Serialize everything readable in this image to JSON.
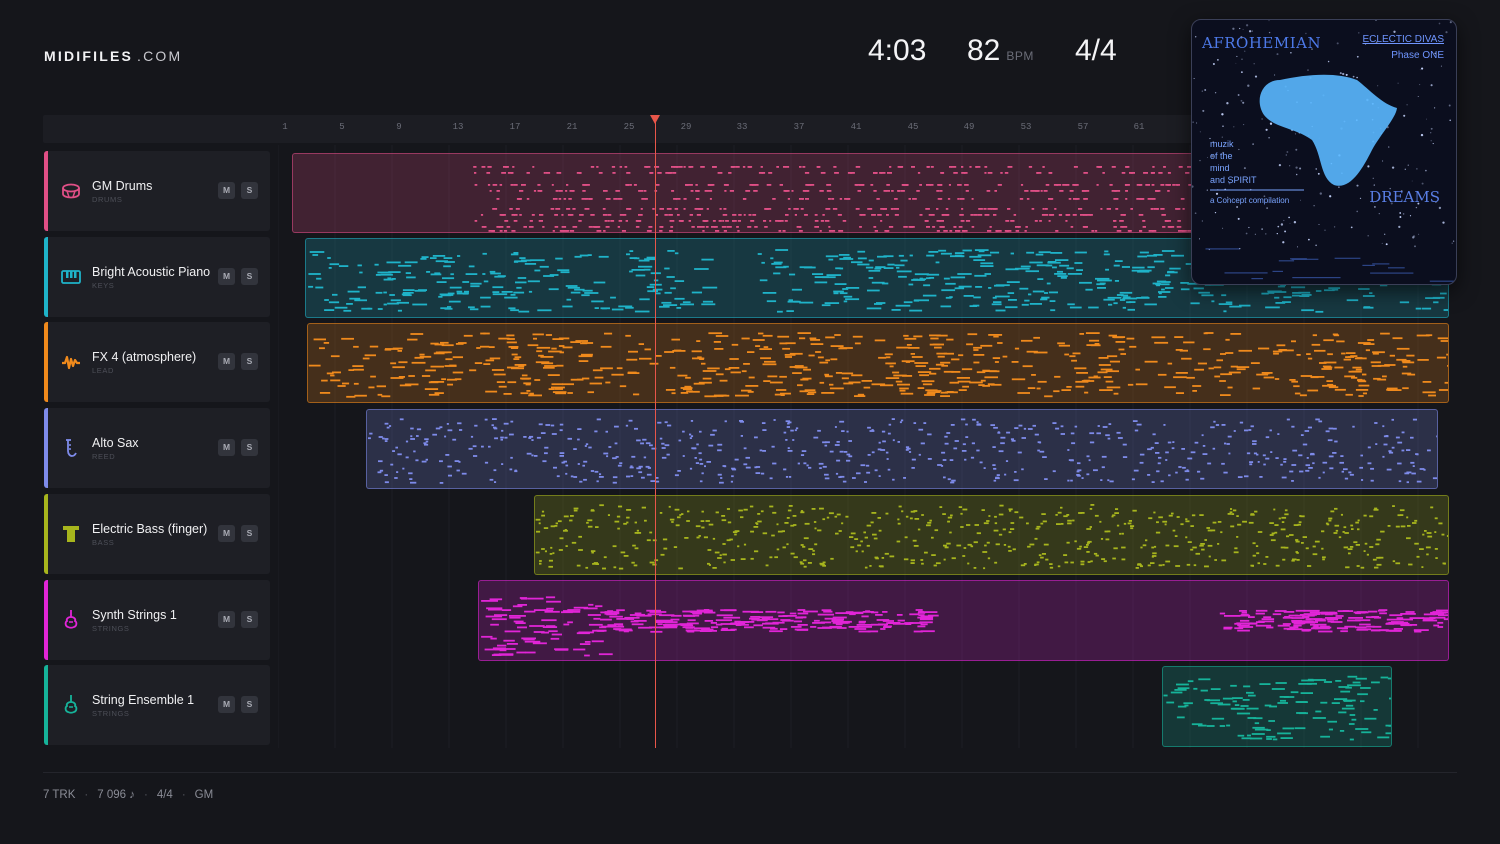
{
  "app": {
    "logo_bold": "MIDIFILES",
    "logo_domain": ".COM"
  },
  "transport": {
    "duration": "4:03",
    "tempo": "82",
    "tempo_unit": "BPM",
    "time_signature": "4/4"
  },
  "ruler": {
    "ticks": [
      "1",
      "5",
      "9",
      "13",
      "17",
      "21",
      "25",
      "29",
      "33",
      "37",
      "41",
      "45",
      "49",
      "53",
      "57",
      "61"
    ]
  },
  "tracks": [
    {
      "name": "GM Drums",
      "category": "DRUMS",
      "icon": "drum-icon",
      "color": "#e04f86",
      "mute": "M",
      "solo": "S"
    },
    {
      "name": "Bright Acoustic Piano",
      "category": "KEYS",
      "icon": "piano-icon",
      "color": "#1fb3c9",
      "mute": "M",
      "solo": "S"
    },
    {
      "name": "FX 4 (atmosphere)",
      "category": "LEAD",
      "icon": "waveform-icon",
      "color": "#f08a1c",
      "mute": "M",
      "solo": "S"
    },
    {
      "name": "Alto Sax",
      "category": "REED",
      "icon": "saxophone-icon",
      "color": "#7e8bea",
      "mute": "M",
      "solo": "S"
    },
    {
      "name": "Electric Bass (finger)",
      "category": "BASS",
      "icon": "bass-icon",
      "color": "#a7b51d",
      "mute": "M",
      "solo": "S"
    },
    {
      "name": "Synth Strings 1",
      "category": "STRINGS",
      "icon": "violin-icon",
      "color": "#e125d7",
      "mute": "M",
      "solo": "S"
    },
    {
      "name": "String Ensemble 1",
      "category": "STRINGS",
      "icon": "violin-icon",
      "color": "#16b39a",
      "mute": "M",
      "solo": "S"
    }
  ],
  "footer": {
    "tracks": "7 TRK",
    "notes": "7 096 ♪",
    "meter": "4/4",
    "standard": "GM"
  },
  "album": {
    "title": "AFROHEMIAN",
    "series_line1": "ECLECTIC DIVAS",
    "series_line2": "Phase ONE",
    "side_line1": "muzik",
    "side_line2": "of the",
    "side_line3": "mind",
    "side_line4": "and SPIRIT",
    "subtitle": "a Concept compilation",
    "bottom": "DREAMS"
  }
}
